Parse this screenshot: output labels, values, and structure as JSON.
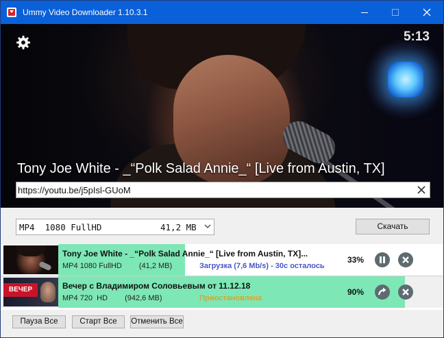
{
  "window": {
    "title": "Ummy Video Downloader 1.10.3.1"
  },
  "player": {
    "timer": "5:13",
    "video_title": "Tony Joe White - _“Polk Salad Annie_“ [Live from Austin, TX]"
  },
  "url_bar": {
    "value": "https://youtu.be/j5pIsl-GUoM"
  },
  "format": {
    "selected_type": "MP4  1080 FullHD",
    "selected_size": "41,2 MB",
    "download_label": "Скачать"
  },
  "downloads": [
    {
      "title": "Tony Joe White - _“Polk Salad Annie_“ [Live from Austin, TX]...",
      "format": "MP4",
      "quality": "1080 FullHD",
      "size": "(41,2 MB)",
      "status": "Загрузка (7,6 Mb/s) - 30с осталось",
      "percent": "33%",
      "progress": 0.33
    },
    {
      "title": "Вечер с Владимиром Соловьевым от 11.12.18",
      "thumb_brand": "ВЕЧЕР",
      "format": "MP4",
      "quality": "720  HD",
      "size": "(942,6 MB)",
      "status": "Приостановлена",
      "percent": "90%",
      "progress": 0.9
    }
  ],
  "footer": {
    "pause_all": "Пауза Все",
    "start_all": "Старт Все",
    "cancel_all": "Отменить Все"
  },
  "colors": {
    "titlebar": "#0a60d8",
    "progress": "#7ee7b6",
    "status_active": "#4a56c6",
    "status_paused": "#d9a42a",
    "action_button": "#5e6b70"
  },
  "icons": {
    "settings": "gear-icon",
    "clear": "close-icon",
    "pause": "pause-icon",
    "resume": "resume-arrow-icon",
    "cancel": "close-circle-icon"
  }
}
